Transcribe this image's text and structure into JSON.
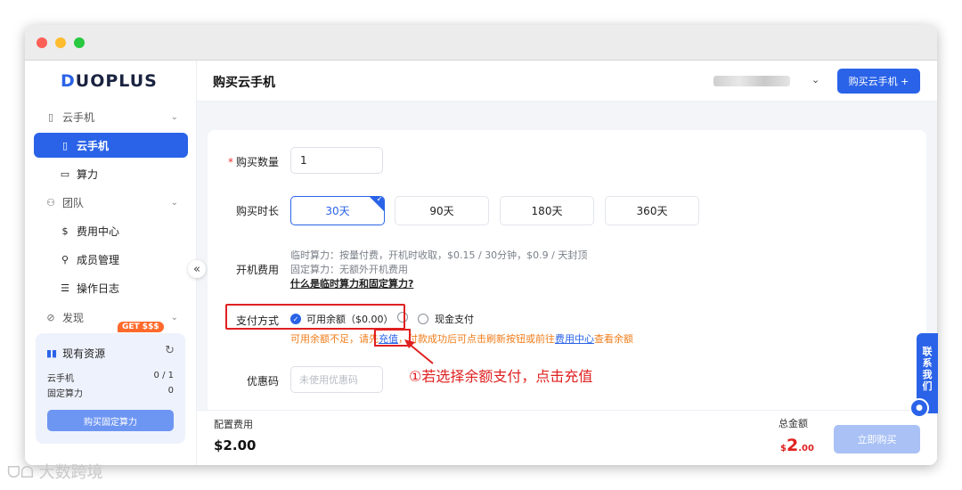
{
  "sidebar": {
    "logo": "DUOPLUS",
    "groups": [
      {
        "label": "云手机",
        "icon": "phone-outline-icon"
      },
      {
        "label": "团队",
        "icon": "users-icon"
      },
      {
        "label": "发现",
        "icon": "compass-icon"
      }
    ],
    "items": [
      {
        "label": "云手机",
        "icon": "phone-icon",
        "active": true
      },
      {
        "label": "算力",
        "icon": "monitor-icon"
      },
      {
        "label": "费用中心",
        "icon": "dollar-circle-icon"
      },
      {
        "label": "成员管理",
        "icon": "member-icon"
      },
      {
        "label": "操作日志",
        "icon": "log-icon"
      }
    ],
    "get_badge": "GET $$$",
    "resources": {
      "title": "现有资源",
      "rows": [
        {
          "label": "云手机",
          "value": "0 / 1"
        },
        {
          "label": "固定算力",
          "value": "0"
        }
      ],
      "button": "购买固定算力"
    },
    "collapse_glyph": "«"
  },
  "header": {
    "title": "购买云手机",
    "buy_button": "购买云手机 +"
  },
  "form": {
    "quantity_label": "购买数量",
    "quantity_value": "1",
    "duration_label": "购买时长",
    "durations": [
      "30天",
      "90天",
      "180天",
      "360天"
    ],
    "selected_duration": "30天",
    "fee_label": "开机费用",
    "fee_lines": [
      "临时算力：按量付费，开机时收取，$0.15 / 30分钟，$0.9 / 天封顶",
      "固定算力：无额外开机费用"
    ],
    "fee_link": "什么是临时算力和固定算力?",
    "payment_label": "支付方式",
    "payment_options": [
      "可用余额（$0.00）",
      "现金支付"
    ],
    "warning": {
      "part1": "可用余额不足，请先",
      "topup_link": "充值",
      "part2": "，付款成功后可点击刷新按钮或前往",
      "fee_center_link": "费用中心",
      "part3": "查看余额"
    },
    "coupon_label": "优惠码",
    "coupon_placeholder": "未使用优惠码"
  },
  "annotation": "①若选择余额支付，点击充值",
  "footer": {
    "config_label": "配置费用",
    "config_value": "$2.00",
    "total_label": "总金额",
    "total_currency": "$",
    "total_integer": "2",
    "total_decimal": ".00",
    "buy_now": "立即购买"
  },
  "contact": "联系我们",
  "watermark": "大数跨境",
  "colors": {
    "accent": "#2a63e8",
    "danger": "#e02020",
    "warning": "#f07d1b"
  }
}
